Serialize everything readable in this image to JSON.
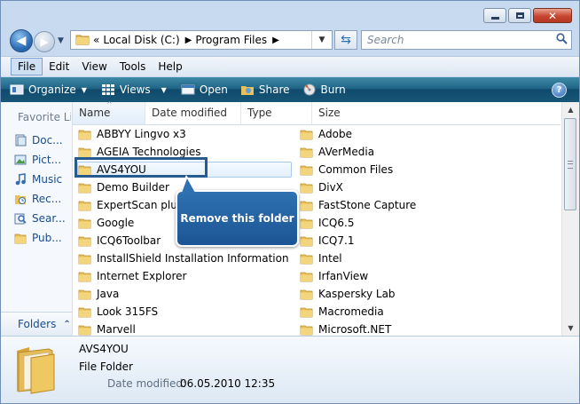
{
  "address": {
    "prefix": "«",
    "crumbs": [
      "Local Disk (C:)",
      "Program Files"
    ]
  },
  "search": {
    "placeholder": "Search"
  },
  "menu": [
    "File",
    "Edit",
    "View",
    "Tools",
    "Help"
  ],
  "commands": {
    "organize": "Organize",
    "views": "Views",
    "open": "Open",
    "share": "Share",
    "burn": "Burn"
  },
  "nav": {
    "favorites_title": "Favorite Links",
    "items": [
      "Doc...",
      "Pict...",
      "Music",
      "Rec...",
      "Sear...",
      "Pub..."
    ],
    "folders_label": "Folders"
  },
  "columns": [
    "Name",
    "Date modified",
    "Type",
    "Size"
  ],
  "files_left": [
    "ABBYY Lingvo x3",
    "AGEIA Technologies",
    "AVS4YOU",
    "Demo Builder",
    "ExpertScan plugi",
    "Google",
    "ICQ6Toolbar",
    "InstallShield Installation Information",
    "Internet Explorer",
    "Java",
    "Look 315FS",
    "Marvell"
  ],
  "files_right": [
    "Adobe",
    "AVerMedia",
    "Common Files",
    "DivX",
    "FastStone Capture",
    "ICQ6.5",
    "ICQ7.1",
    "Intel",
    "IrfanView",
    "Kaspersky Lab",
    "Macromedia",
    "Microsoft.NET"
  ],
  "callout": {
    "text": "Remove this folder"
  },
  "details": {
    "name": "AVS4YOU",
    "type": "File Folder",
    "modified_label": "Date modified:",
    "modified_value": "06.05.2010 12:35"
  },
  "colors": {
    "accent": "#1c5594",
    "command_bar": "#1f6486",
    "folder": "#e8c15a"
  }
}
